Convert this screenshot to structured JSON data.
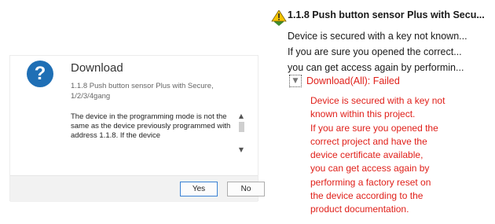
{
  "dialog": {
    "title": "Download",
    "subtitle": "1.1.8 Push button sensor Plus with Secure, 1/2/3/4gang",
    "message": "The device in the programming mode is not the same as the device previously programmed with address 1.1.8. If the device",
    "yes_label": "Yes",
    "no_label": "No",
    "icon": "question-icon",
    "accent": "#1f6fb5"
  },
  "tree": {
    "title": "1.1.8 Push button sensor Plus with Secu...",
    "icon": "warning-icon",
    "lines": [
      "Device is secured with a key not known...",
      "If you are sure you opened the correct...",
      "you can get access again by performin..."
    ],
    "child": {
      "title": "Download(All): Failed",
      "color": "#e0201a",
      "lines": [
        "Device is secured with a key not",
        "known within this project.",
        "If you are sure you opened the",
        "correct project and have the",
        "device certificate available,",
        "you can get access again by",
        "performing a factory reset on",
        "the device according to the",
        "product documentation."
      ]
    }
  }
}
